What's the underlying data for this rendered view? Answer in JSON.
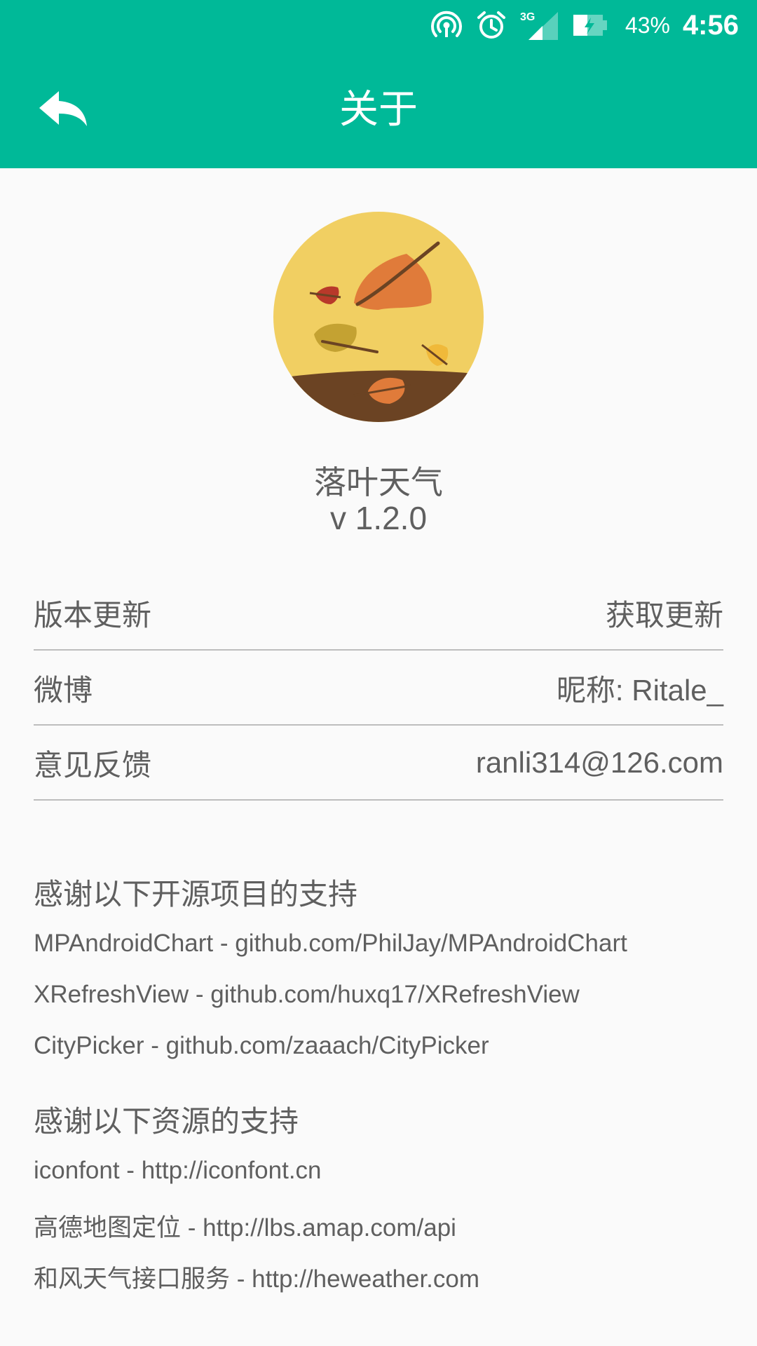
{
  "status_bar": {
    "battery_percent": "43%",
    "time": "4:56",
    "network_type": "3G",
    "icons": [
      "hotspot-icon",
      "alarm-icon",
      "signal-icon",
      "battery-icon"
    ]
  },
  "header": {
    "title": "关于",
    "back_icon": "back-arrow-icon",
    "background_color": "#00b998"
  },
  "app": {
    "name": "落叶天气",
    "version": "v 1.2.0",
    "logo_icon": "falling-leaves-logo"
  },
  "info_rows": [
    {
      "label": "版本更新",
      "value": "获取更新"
    },
    {
      "label": "微博",
      "value": "昵称: Ritale_"
    },
    {
      "label": "意见反馈",
      "value": "ranli314@126.com"
    }
  ],
  "open_source": {
    "title": "感谢以下开源项目的支持",
    "items": [
      "MPAndroidChart - github.com/PhilJay/MPAndroidChart",
      "XRefreshView - github.com/huxq17/XRefreshView",
      "CityPicker - github.com/zaaach/CityPicker"
    ]
  },
  "resources": {
    "title": "感谢以下资源的支持",
    "items": [
      "iconfont - http://iconfont.cn",
      "高德地图定位 - http://lbs.amap.com/api",
      "和风天气接口服务 - http://heweather.com"
    ]
  },
  "colors": {
    "accent": "#00b998",
    "text": "#5f5f5f",
    "divider": "#bdbdbd",
    "background": "#fafafa"
  }
}
